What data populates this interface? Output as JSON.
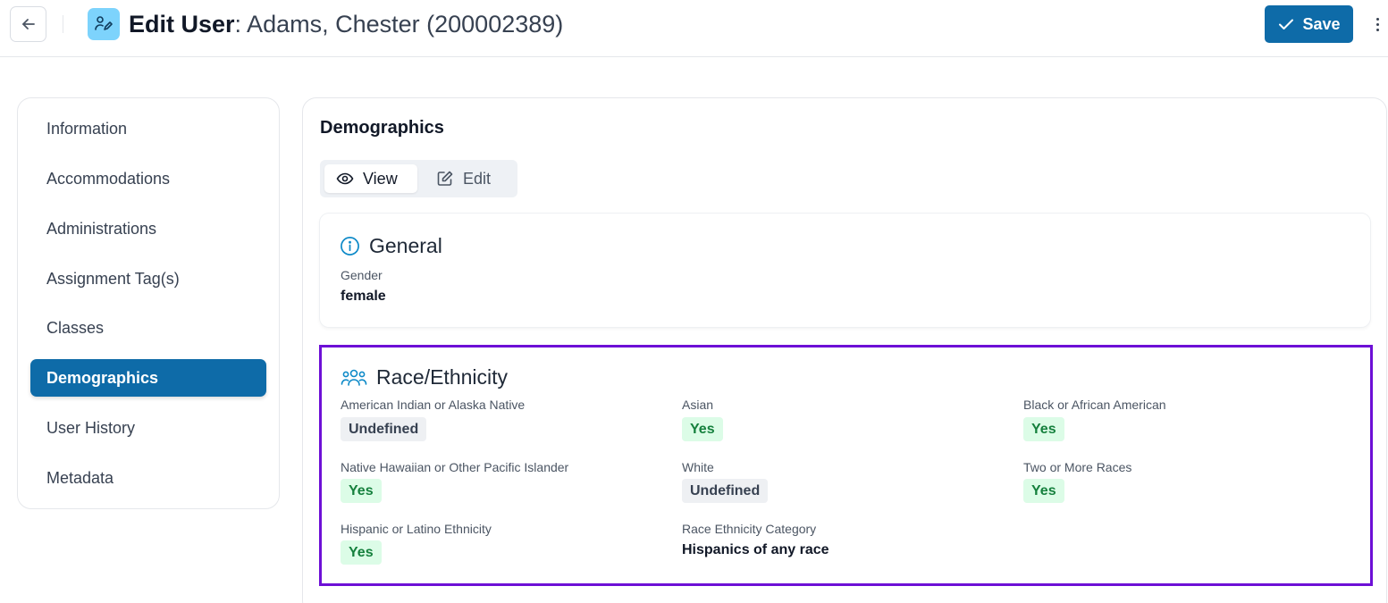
{
  "header": {
    "title_bold": "Edit User",
    "title_rest": ": Adams, Chester (200002389)",
    "save_label": "Save",
    "colors": {
      "primary": "#0e6ba8",
      "title_icon_bg": "#7dd3fc"
    }
  },
  "sidebar": {
    "items": [
      {
        "label": "Information",
        "active": false
      },
      {
        "label": "Accommodations",
        "active": false
      },
      {
        "label": "Administrations",
        "active": false
      },
      {
        "label": "Assignment Tag(s)",
        "active": false
      },
      {
        "label": "Classes",
        "active": false
      },
      {
        "label": "Demographics",
        "active": true
      },
      {
        "label": "User History",
        "active": false
      },
      {
        "label": "Metadata",
        "active": false
      }
    ]
  },
  "main": {
    "title": "Demographics",
    "view_toggle": {
      "view_label": "View",
      "edit_label": "Edit",
      "selected": "View"
    },
    "general": {
      "heading": "General",
      "icon": "info-icon",
      "gender_label": "Gender",
      "gender_value": "female"
    },
    "race": {
      "heading": "Race/Ethnicity",
      "icon": "users-icon",
      "highlight_color": "#6d0fd6",
      "fields": [
        {
          "label": "American Indian or Alaska Native",
          "value": "Undefined",
          "kind": "undefined"
        },
        {
          "label": "Asian",
          "value": "Yes",
          "kind": "yes"
        },
        {
          "label": "Black or African American",
          "value": "Yes",
          "kind": "yes"
        },
        {
          "label": "Native Hawaiian or Other Pacific Islander",
          "value": "Yes",
          "kind": "yes"
        },
        {
          "label": "White",
          "value": "Undefined",
          "kind": "undefined"
        },
        {
          "label": "Two or More Races",
          "value": "Yes",
          "kind": "yes"
        },
        {
          "label": "Hispanic or Latino Ethnicity",
          "value": "Yes",
          "kind": "yes"
        }
      ],
      "category_label": "Race Ethnicity Category",
      "category_value": "Hispanics of any race"
    }
  }
}
